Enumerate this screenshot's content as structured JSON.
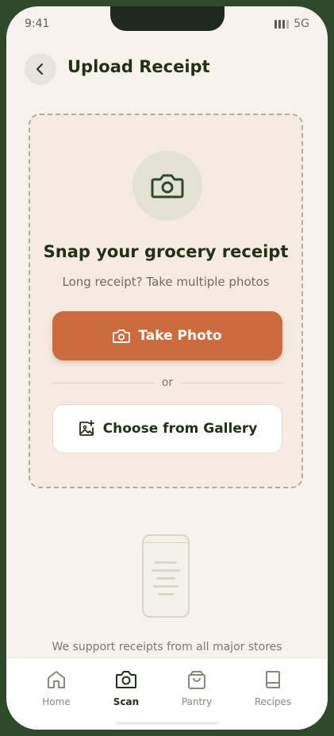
{
  "status": {
    "time": "9:41",
    "network": "5G"
  },
  "header": {
    "title": "Upload Receipt"
  },
  "upload": {
    "headline": "Snap your grocery receipt",
    "subline": "Long receipt? Take multiple photos",
    "take_photo": "Take Photo",
    "or": "or",
    "gallery": "Choose from Gallery"
  },
  "support_text": "We support receipts from all major stores",
  "tabs": [
    {
      "label": "Home",
      "icon": "home-icon"
    },
    {
      "label": "Scan",
      "icon": "camera-icon",
      "active": true
    },
    {
      "label": "Pantry",
      "icon": "shopping-bag-icon"
    },
    {
      "label": "Recipes",
      "icon": "book-icon"
    }
  ],
  "colors": {
    "accent": "#cc6b3d",
    "dark_green": "#223018",
    "background": "#f7f2ec"
  }
}
